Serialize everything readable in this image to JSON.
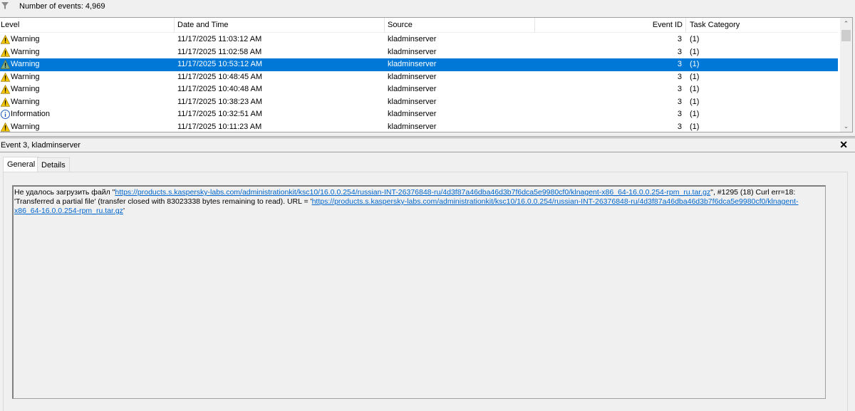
{
  "toolbar": {
    "count_label": "Number of events: 4,969"
  },
  "columns": [
    "Level",
    "Date and Time",
    "Source",
    "Event ID",
    "Task Category"
  ],
  "rows": [
    {
      "level": "Warning",
      "datetime": "11/17/2025 11:03:12 AM",
      "source": "kladminserver",
      "event_id": "3",
      "category": "(1)"
    },
    {
      "level": "Warning",
      "datetime": "11/17/2025 11:02:58 AM",
      "source": "kladminserver",
      "event_id": "3",
      "category": "(1)"
    },
    {
      "level": "Warning",
      "datetime": "11/17/2025 10:53:12 AM",
      "source": "kladminserver",
      "event_id": "3",
      "category": "(1)",
      "selected": true
    },
    {
      "level": "Warning",
      "datetime": "11/17/2025 10:48:45 AM",
      "source": "kladminserver",
      "event_id": "3",
      "category": "(1)"
    },
    {
      "level": "Warning",
      "datetime": "11/17/2025 10:40:48 AM",
      "source": "kladminserver",
      "event_id": "3",
      "category": "(1)"
    },
    {
      "level": "Warning",
      "datetime": "11/17/2025 10:38:23 AM",
      "source": "kladminserver",
      "event_id": "3",
      "category": "(1)"
    },
    {
      "level": "Information",
      "datetime": "11/17/2025 10:32:51 AM",
      "source": "kladminserver",
      "event_id": "3",
      "category": "(1)"
    },
    {
      "level": "Warning",
      "datetime": "11/17/2025 10:11:23 AM",
      "source": "kladminserver",
      "event_id": "3",
      "category": "(1)"
    }
  ],
  "detail": {
    "title": "Event 3, kladminserver",
    "tabs": [
      "General",
      "Details"
    ],
    "message": {
      "prefix": "Не удалось загрузить файл \"",
      "url1": "https://products.s.kaspersky-labs.com/administrationkit/ksc10/16.0.0.254/russian-INT-26376848-ru/4d3f87a46dba46d3b7f6dca5e9980cf0/klnagent-x86_64-16.0.0.254-rpm_ru.tar.gz",
      "middle": "\", #1295 (18) Curl err=18: 'Transferred a partial file' (transfer closed with 83023338 bytes remaining to read). URL = '",
      "url2": "https://products.s.kaspersky-labs.com/administrationkit/ksc10/16.0.0.254/russian-INT-26376848-ru/4d3f87a46dba46d3b7f6dca5e9980cf0/klnagent-x86_64-16.0.0.254-rpm_ru.tar.gz",
      "suffix": "'"
    }
  },
  "colors": {
    "selection": "#0078d7",
    "warning": "#f5c400",
    "info": "#1c5bb8",
    "link": "#0066cc"
  }
}
